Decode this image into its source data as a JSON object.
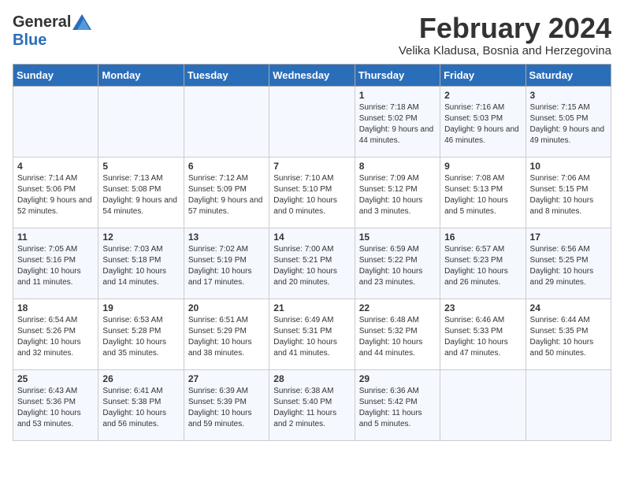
{
  "header": {
    "logo_general": "General",
    "logo_blue": "Blue",
    "month_title": "February 2024",
    "location": "Velika Kladusa, Bosnia and Herzegovina"
  },
  "days_of_week": [
    "Sunday",
    "Monday",
    "Tuesday",
    "Wednesday",
    "Thursday",
    "Friday",
    "Saturday"
  ],
  "weeks": [
    [
      {
        "day": "",
        "info": ""
      },
      {
        "day": "",
        "info": ""
      },
      {
        "day": "",
        "info": ""
      },
      {
        "day": "",
        "info": ""
      },
      {
        "day": "1",
        "info": "Sunrise: 7:18 AM\nSunset: 5:02 PM\nDaylight: 9 hours\nand 44 minutes."
      },
      {
        "day": "2",
        "info": "Sunrise: 7:16 AM\nSunset: 5:03 PM\nDaylight: 9 hours\nand 46 minutes."
      },
      {
        "day": "3",
        "info": "Sunrise: 7:15 AM\nSunset: 5:05 PM\nDaylight: 9 hours\nand 49 minutes."
      }
    ],
    [
      {
        "day": "4",
        "info": "Sunrise: 7:14 AM\nSunset: 5:06 PM\nDaylight: 9 hours\nand 52 minutes."
      },
      {
        "day": "5",
        "info": "Sunrise: 7:13 AM\nSunset: 5:08 PM\nDaylight: 9 hours\nand 54 minutes."
      },
      {
        "day": "6",
        "info": "Sunrise: 7:12 AM\nSunset: 5:09 PM\nDaylight: 9 hours\nand 57 minutes."
      },
      {
        "day": "7",
        "info": "Sunrise: 7:10 AM\nSunset: 5:10 PM\nDaylight: 10 hours\nand 0 minutes."
      },
      {
        "day": "8",
        "info": "Sunrise: 7:09 AM\nSunset: 5:12 PM\nDaylight: 10 hours\nand 3 minutes."
      },
      {
        "day": "9",
        "info": "Sunrise: 7:08 AM\nSunset: 5:13 PM\nDaylight: 10 hours\nand 5 minutes."
      },
      {
        "day": "10",
        "info": "Sunrise: 7:06 AM\nSunset: 5:15 PM\nDaylight: 10 hours\nand 8 minutes."
      }
    ],
    [
      {
        "day": "11",
        "info": "Sunrise: 7:05 AM\nSunset: 5:16 PM\nDaylight: 10 hours\nand 11 minutes."
      },
      {
        "day": "12",
        "info": "Sunrise: 7:03 AM\nSunset: 5:18 PM\nDaylight: 10 hours\nand 14 minutes."
      },
      {
        "day": "13",
        "info": "Sunrise: 7:02 AM\nSunset: 5:19 PM\nDaylight: 10 hours\nand 17 minutes."
      },
      {
        "day": "14",
        "info": "Sunrise: 7:00 AM\nSunset: 5:21 PM\nDaylight: 10 hours\nand 20 minutes."
      },
      {
        "day": "15",
        "info": "Sunrise: 6:59 AM\nSunset: 5:22 PM\nDaylight: 10 hours\nand 23 minutes."
      },
      {
        "day": "16",
        "info": "Sunrise: 6:57 AM\nSunset: 5:23 PM\nDaylight: 10 hours\nand 26 minutes."
      },
      {
        "day": "17",
        "info": "Sunrise: 6:56 AM\nSunset: 5:25 PM\nDaylight: 10 hours\nand 29 minutes."
      }
    ],
    [
      {
        "day": "18",
        "info": "Sunrise: 6:54 AM\nSunset: 5:26 PM\nDaylight: 10 hours\nand 32 minutes."
      },
      {
        "day": "19",
        "info": "Sunrise: 6:53 AM\nSunset: 5:28 PM\nDaylight: 10 hours\nand 35 minutes."
      },
      {
        "day": "20",
        "info": "Sunrise: 6:51 AM\nSunset: 5:29 PM\nDaylight: 10 hours\nand 38 minutes."
      },
      {
        "day": "21",
        "info": "Sunrise: 6:49 AM\nSunset: 5:31 PM\nDaylight: 10 hours\nand 41 minutes."
      },
      {
        "day": "22",
        "info": "Sunrise: 6:48 AM\nSunset: 5:32 PM\nDaylight: 10 hours\nand 44 minutes."
      },
      {
        "day": "23",
        "info": "Sunrise: 6:46 AM\nSunset: 5:33 PM\nDaylight: 10 hours\nand 47 minutes."
      },
      {
        "day": "24",
        "info": "Sunrise: 6:44 AM\nSunset: 5:35 PM\nDaylight: 10 hours\nand 50 minutes."
      }
    ],
    [
      {
        "day": "25",
        "info": "Sunrise: 6:43 AM\nSunset: 5:36 PM\nDaylight: 10 hours\nand 53 minutes."
      },
      {
        "day": "26",
        "info": "Sunrise: 6:41 AM\nSunset: 5:38 PM\nDaylight: 10 hours\nand 56 minutes."
      },
      {
        "day": "27",
        "info": "Sunrise: 6:39 AM\nSunset: 5:39 PM\nDaylight: 10 hours\nand 59 minutes."
      },
      {
        "day": "28",
        "info": "Sunrise: 6:38 AM\nSunset: 5:40 PM\nDaylight: 11 hours\nand 2 minutes."
      },
      {
        "day": "29",
        "info": "Sunrise: 6:36 AM\nSunset: 5:42 PM\nDaylight: 11 hours\nand 5 minutes."
      },
      {
        "day": "",
        "info": ""
      },
      {
        "day": "",
        "info": ""
      }
    ]
  ]
}
